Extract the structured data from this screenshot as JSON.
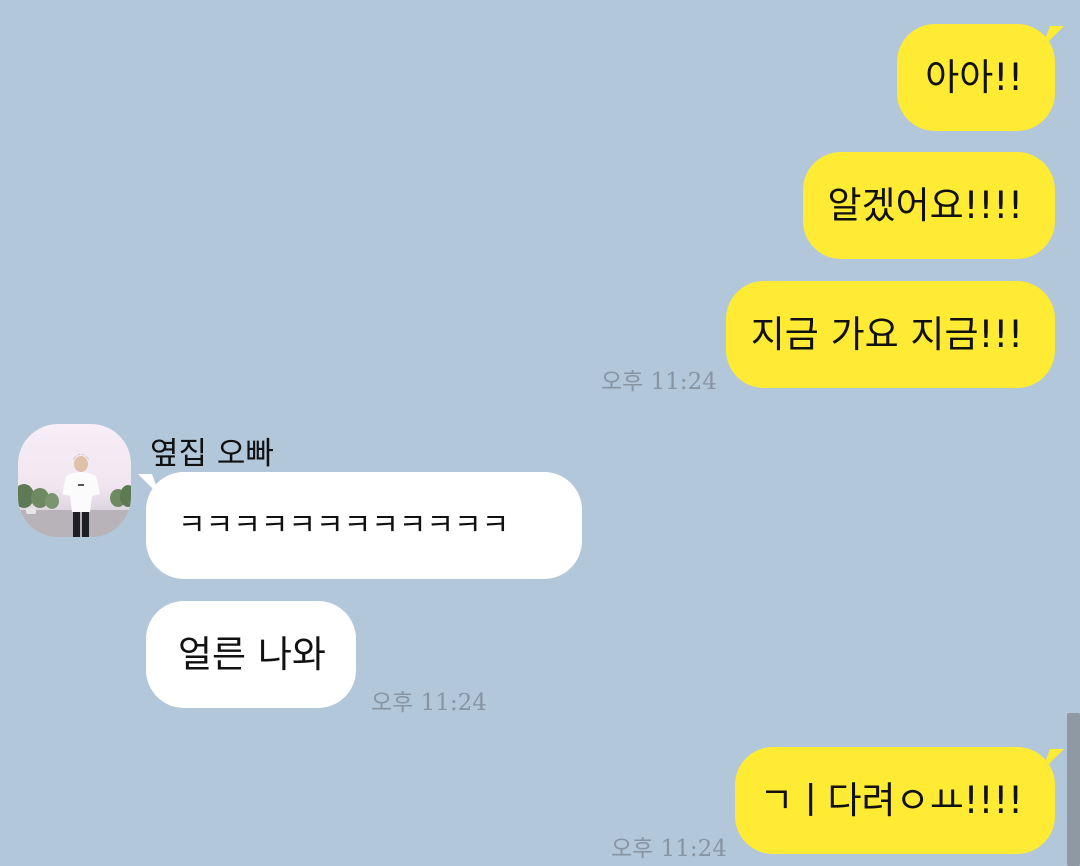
{
  "messages": {
    "me_1": "아아!!",
    "me_2": "알겠어요!!!!",
    "me_3": "지금 가요 지금!!!",
    "me_time_1": "오후 11:24",
    "sender_name": "옆집 오빠",
    "other_1": "ㅋㅋㅋㅋㅋㅋㅋㅋㅋㅋㅋㅋ",
    "other_2": "얼른 나와",
    "other_time": "오후 11:24",
    "me_4": "ㄱㅣ다려ㅇㅛ!!!!",
    "me_time_2": "오후 11:24"
  },
  "colors": {
    "background": "#b2c7da",
    "my_bubble": "#ffeb33",
    "other_bubble": "#ffffff",
    "timestamp": "#8795a3"
  },
  "icons": {
    "avatar": "profile-photo"
  }
}
